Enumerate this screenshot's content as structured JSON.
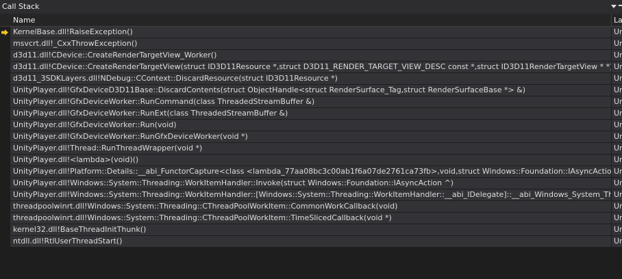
{
  "window": {
    "title": "Call Stack"
  },
  "columns": {
    "name": "Name",
    "language": "La"
  },
  "colors": {
    "current_frame_arrow": "#f5c518",
    "row_background": "#333337",
    "panel_background": "#1e1e1e"
  },
  "frames": [
    {
      "name": "KernelBase.dll!RaiseException()",
      "language": "Ur",
      "current": true
    },
    {
      "name": "msvcrt.dll!_CxxThrowException()",
      "language": "Ur"
    },
    {
      "name": "d3d11.dll!CDevice::CreateRenderTargetView_Worker()",
      "language": "Ur"
    },
    {
      "name": "d3d11.dll!CDevice::CreateRenderTargetView(struct ID3D11Resource *,struct D3D11_RENDER_TARGET_VIEW_DESC const *,struct ID3D11RenderTargetView * *)",
      "language": "Ur"
    },
    {
      "name": "d3d11_3SDKLayers.dll!NDebug::CContext::DiscardResource(struct ID3D11Resource *)",
      "language": "Ur"
    },
    {
      "name": "UnityPlayer.dll!GfxDeviceD3D11Base::DiscardContents(struct ObjectHandle<struct RenderSurface_Tag,struct RenderSurfaceBase *> &)",
      "language": "Ur"
    },
    {
      "name": "UnityPlayer.dll!GfxDeviceWorker::RunCommand(class ThreadedStreamBuffer &)",
      "language": "Ur"
    },
    {
      "name": "UnityPlayer.dll!GfxDeviceWorker::RunExt(class ThreadedStreamBuffer &)",
      "language": "Ur"
    },
    {
      "name": "UnityPlayer.dll!GfxDeviceWorker::Run(void)",
      "language": "Ur"
    },
    {
      "name": "UnityPlayer.dll!GfxDeviceWorker::RunGfxDeviceWorker(void *)",
      "language": "Ur"
    },
    {
      "name": "UnityPlayer.dll!Thread::RunThreadWrapper(void *)",
      "language": "Ur"
    },
    {
      "name": "UnityPlayer.dll!<lambda>(void)()",
      "language": "Ur"
    },
    {
      "name": "UnityPlayer.dll!Platform::Details::__abi_FunctorCapture<class <lambda_77aa08bc3c00ab1f6a07de2761ca73fb>,void,struct Windows::Foundation::IAsyncAction ^>::Invo",
      "language": "Ur"
    },
    {
      "name": "UnityPlayer.dll!Windows::System::Threading::WorkItemHandler::Invoke(struct Windows::Foundation::IAsyncAction ^)",
      "language": "Ur"
    },
    {
      "name": "UnityPlayer.dll!Windows::System::Threading::WorkItemHandler::[Windows::System::Threading::WorkItemHandler::__abi_IDelegate]::__abi_Windows_System_Threading",
      "language": "Ur"
    },
    {
      "name": "threadpoolwinrt.dll!Windows::System::Threading::CThreadPoolWorkItem::CommonWorkCallback(void)",
      "language": "Ur"
    },
    {
      "name": "threadpoolwinrt.dll!Windows::System::Threading::CThreadPoolWorkItem::TimeSlicedCallback(void *)",
      "language": "Ur"
    },
    {
      "name": "kernel32.dll!BaseThreadInitThunk()",
      "language": "Ur"
    },
    {
      "name": "ntdll.dll!RtlUserThreadStart()",
      "language": "Ur"
    }
  ]
}
